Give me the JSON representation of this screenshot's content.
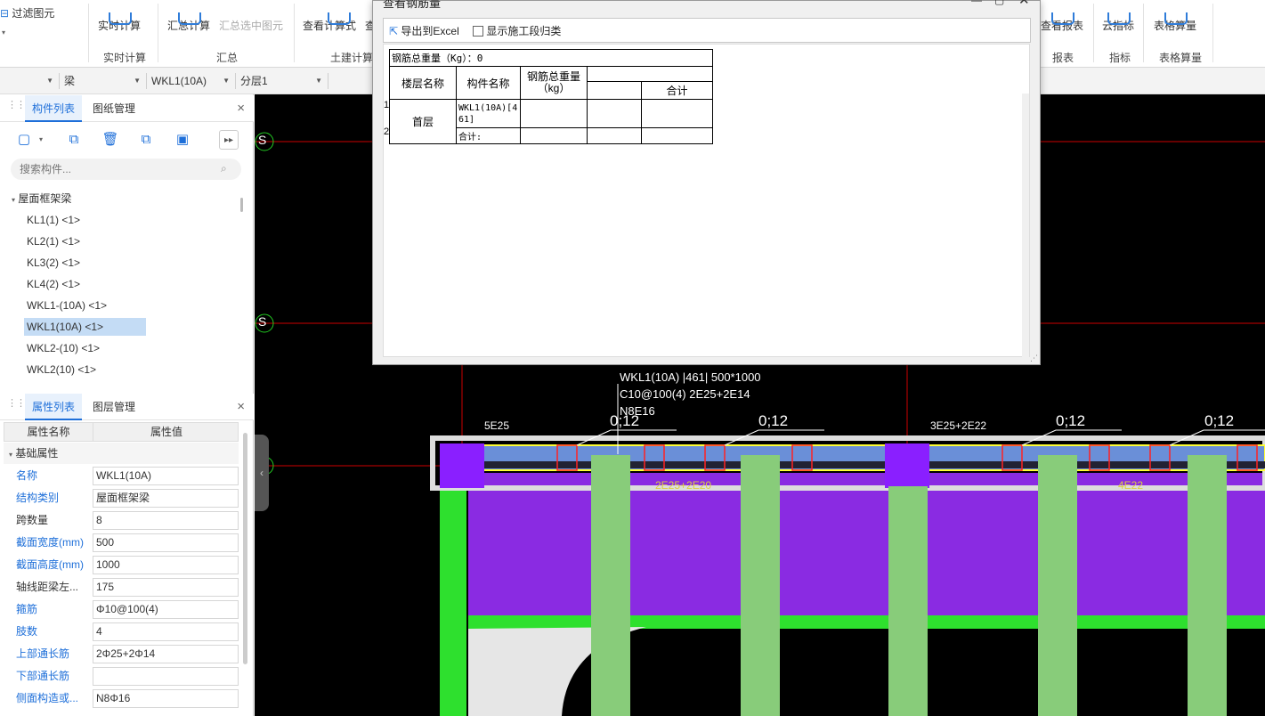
{
  "ribbon": {
    "buttons": [
      {
        "label": "过滤图元",
        "disabled": false
      },
      {
        "label": "实时计算",
        "disabled": false
      },
      {
        "label": "汇总计算",
        "disabled": false
      },
      {
        "label": "汇总选中图元",
        "disabled": true
      },
      {
        "label": "查看计算式",
        "disabled": false
      },
      {
        "label": "查",
        "disabled": false
      },
      {
        "label": "查看报表",
        "disabled": false
      },
      {
        "label": "云指标",
        "disabled": false
      },
      {
        "label": "表格算量",
        "disabled": false
      }
    ],
    "groups": [
      "实时计算",
      "汇总",
      "土建计算",
      "报表",
      "指标",
      "表格算量"
    ]
  },
  "selectors": {
    "category": "梁",
    "component": "WKL1(10A)",
    "layer": "分层1"
  },
  "component_panel": {
    "tab_active": "构件列表",
    "tab_other": "图纸管理",
    "search_placeholder": "搜索构件...",
    "root": "屋面框架梁",
    "items": [
      "KL1(1) <1>",
      "KL2(1) <1>",
      "KL3(2) <1>",
      "KL4(2) <1>",
      "WKL1-(10A) <1>",
      "WKL1(10A) <1>",
      "WKL2-(10) <1>",
      "WKL2(10) <1>"
    ],
    "selected_index": 5
  },
  "property_panel": {
    "tab_active": "属性列表",
    "tab_other": "图层管理",
    "col_name": "属性名称",
    "col_value": "属性值",
    "section": "基础属性",
    "rows": [
      {
        "name": "名称",
        "value": "WKL1(10A)",
        "blue": true
      },
      {
        "name": "结构类别",
        "value": "屋面框架梁",
        "blue": true
      },
      {
        "name": "跨数量",
        "value": "8",
        "blue": false
      },
      {
        "name": "截面宽度(mm)",
        "value": "500",
        "blue": true
      },
      {
        "name": "截面高度(mm)",
        "value": "1000",
        "blue": true
      },
      {
        "name": "轴线距梁左...",
        "value": "175",
        "blue": false
      },
      {
        "name": "箍筋",
        "value": "Φ10@100(4)",
        "blue": true
      },
      {
        "name": "肢数",
        "value": "4",
        "blue": true
      },
      {
        "name": "上部通长筋",
        "value": "2Φ25+2Φ14",
        "blue": true
      },
      {
        "name": "下部通长筋",
        "value": "",
        "blue": true
      },
      {
        "name": "侧面构造或...",
        "value": "N8Φ16",
        "blue": true
      }
    ]
  },
  "dialog": {
    "title": "查看钢筋量",
    "export_label": "导出到Excel",
    "checkbox_label": "显示施工段归类",
    "total_weight": "钢筋总重量（Kg）：0",
    "col_floor": "楼层名称",
    "col_component": "构件名称",
    "col_total": "钢筋总重量（kg）",
    "col_sum": "合计",
    "row_floor": "首层",
    "row_component": "WKL1(10A)[461]",
    "row_subtotal": "合计:",
    "row_nums": [
      "1",
      "2"
    ]
  },
  "canvas": {
    "axis_label": "S",
    "beam_label_line1": "WKL1(10A) |461| 500*1000",
    "beam_label_line2": "C10@100(4) 2E25+2E14",
    "beam_label_line3": "N8E16",
    "support_top_left": "5E25",
    "support_top_mid": "3E25+2E22",
    "stirrup_labels": [
      "0;12",
      "0;12",
      "0;12",
      "0;12"
    ],
    "bottom_labels": [
      "2E25+2E20",
      "4E22"
    ]
  }
}
